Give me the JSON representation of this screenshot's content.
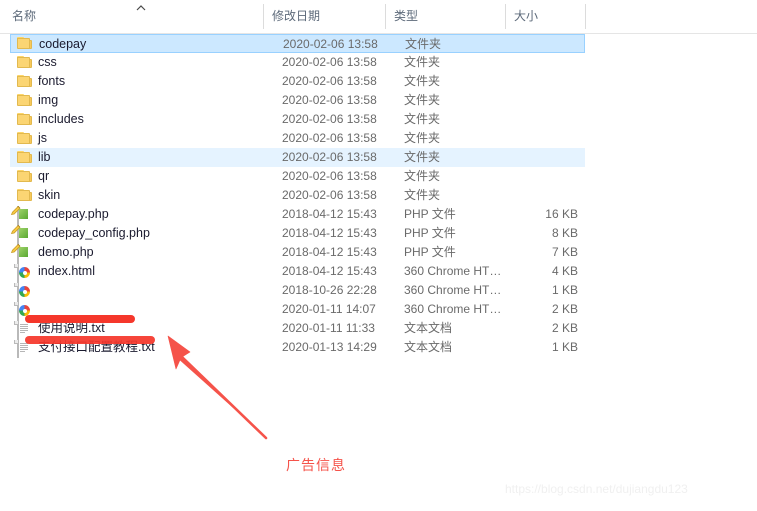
{
  "header": {
    "columns": [
      {
        "label": "名称",
        "key": "name"
      },
      {
        "label": "修改日期",
        "key": "date"
      },
      {
        "label": "类型",
        "key": "type"
      },
      {
        "label": "大小",
        "key": "size"
      }
    ],
    "sort": {
      "column": "名称",
      "direction": "ascending",
      "indicator_icon": "sort-ascending-caret-icon"
    }
  },
  "rows": [
    {
      "name": "codepay",
      "date": "2020-02-06 13:58",
      "type": "文件夹",
      "size": "",
      "icon": "folder-icon",
      "state": "selected",
      "redacted": false
    },
    {
      "name": "css",
      "date": "2020-02-06 13:58",
      "type": "文件夹",
      "size": "",
      "icon": "folder-icon",
      "state": "normal",
      "redacted": false
    },
    {
      "name": "fonts",
      "date": "2020-02-06 13:58",
      "type": "文件夹",
      "size": "",
      "icon": "folder-icon",
      "state": "normal",
      "redacted": false
    },
    {
      "name": "img",
      "date": "2020-02-06 13:58",
      "type": "文件夹",
      "size": "",
      "icon": "folder-icon",
      "state": "normal",
      "redacted": false
    },
    {
      "name": "includes",
      "date": "2020-02-06 13:58",
      "type": "文件夹",
      "size": "",
      "icon": "folder-icon",
      "state": "normal",
      "redacted": false
    },
    {
      "name": "js",
      "date": "2020-02-06 13:58",
      "type": "文件夹",
      "size": "",
      "icon": "folder-icon",
      "state": "normal",
      "redacted": false
    },
    {
      "name": "lib",
      "date": "2020-02-06 13:58",
      "type": "文件夹",
      "size": "",
      "icon": "folder-icon",
      "state": "hover",
      "redacted": false
    },
    {
      "name": "qr",
      "date": "2020-02-06 13:58",
      "type": "文件夹",
      "size": "",
      "icon": "folder-icon",
      "state": "normal",
      "redacted": false
    },
    {
      "name": "skin",
      "date": "2020-02-06 13:58",
      "type": "文件夹",
      "size": "",
      "icon": "folder-icon",
      "state": "normal",
      "redacted": false
    },
    {
      "name": "codepay.php",
      "date": "2018-04-12 15:43",
      "type": "PHP 文件",
      "size": "16 KB",
      "icon": "php-file-icon",
      "state": "normal",
      "redacted": false
    },
    {
      "name": "codepay_config.php",
      "date": "2018-04-12 15:43",
      "type": "PHP 文件",
      "size": "8 KB",
      "icon": "php-file-icon",
      "state": "normal",
      "redacted": false
    },
    {
      "name": "demo.php",
      "date": "2018-04-12 15:43",
      "type": "PHP 文件",
      "size": "7 KB",
      "icon": "php-file-icon",
      "state": "normal",
      "redacted": false
    },
    {
      "name": "index.html",
      "date": "2018-04-12 15:43",
      "type": "360 Chrome HT…",
      "size": "4 KB",
      "icon": "chrome-html-icon",
      "state": "normal",
      "redacted": false
    },
    {
      "name": "",
      "date": "2018-10-26 22:28",
      "type": "360 Chrome HT…",
      "size": "1 KB",
      "icon": "chrome-html-icon",
      "state": "normal",
      "redacted": true
    },
    {
      "name": "",
      "date": "2020-01-11 14:07",
      "type": "360 Chrome HT…",
      "size": "2 KB",
      "icon": "chrome-html-icon",
      "state": "normal",
      "redacted": true
    },
    {
      "name": "使用说明.txt",
      "date": "2020-01-11 11:33",
      "type": "文本文档",
      "size": "2 KB",
      "icon": "text-file-icon",
      "state": "normal",
      "redacted": false
    },
    {
      "name": "支付接口配置教程.txt",
      "date": "2020-01-13 14:29",
      "type": "文本文档",
      "size": "1 KB",
      "icon": "text-file-icon",
      "state": "normal",
      "redacted": false
    }
  ],
  "annotations": {
    "callout_text": "广告信息",
    "callout_color": "#f5534a",
    "redaction_color": "#f5372b",
    "arrow_color": "#f5534a",
    "arrow_icon": "arrow-pointing-up-left-icon"
  },
  "watermark": {
    "text": "https://blog.csdn.net/dujiangdu123"
  },
  "colors": {
    "selected_row": "#cce8ff",
    "selected_border": "#99d1ff",
    "hover_row": "#e5f3ff",
    "header_text": "#5d6a7a",
    "name_text": "#1a1a2e",
    "meta_text": "#6a6a6a"
  }
}
